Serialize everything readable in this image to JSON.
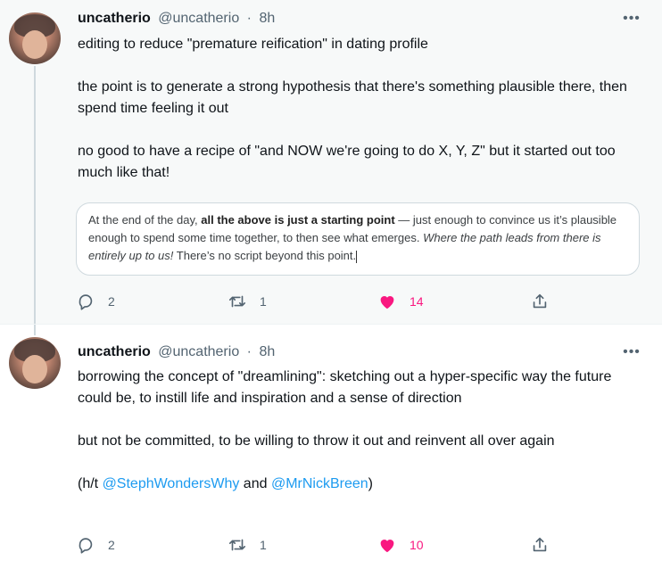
{
  "tweets": [
    {
      "name": "uncatherio",
      "handle": "@uncatherio",
      "separator": "·",
      "time": "8h",
      "more": "•••",
      "paragraphs": [
        "editing to reduce \"premature reification\" in dating profile",
        "the point is to generate a strong hypothesis that there's something plausible there, then spend time feeling it out",
        "no good to have a recipe of \"and NOW we're going to do X, Y, Z\" but it started out too much like that!"
      ],
      "quote": {
        "part1": "At the end of the day, ",
        "bold": "all the above is just a starting point",
        "part2": " — just enough to convince us it’s plausible enough to spend some time together, to then see what emerges. ",
        "italic": "Where the path leads from there is entirely up to us!",
        "part3": " There’s no script beyond this point."
      },
      "replies": "2",
      "retweets": "1",
      "likes": "14"
    },
    {
      "name": "uncatherio",
      "handle": "@uncatherio",
      "separator": "·",
      "time": "8h",
      "more": "•••",
      "paragraphs": [
        "borrowing the concept of \"dreamlining\": sketching out a hyper-specific way the future could be, to instill life and inspiration and a sense of direction",
        "but not be committed, to be willing to throw it out and reinvent all over again"
      ],
      "ht": {
        "prefix": "(h/t ",
        "mention1": "@StephWondersWhy",
        "and": " and ",
        "mention2": "@MrNickBreen",
        "suffix": ")"
      },
      "replies": "2",
      "retweets": "1",
      "likes": "10"
    }
  ],
  "colors": {
    "accent": "#1d9bf0",
    "like": "#f91880",
    "muted": "#536471"
  },
  "icons": [
    "reply-icon",
    "retweet-icon",
    "heart-filled-icon",
    "share-icon",
    "more-icon"
  ]
}
